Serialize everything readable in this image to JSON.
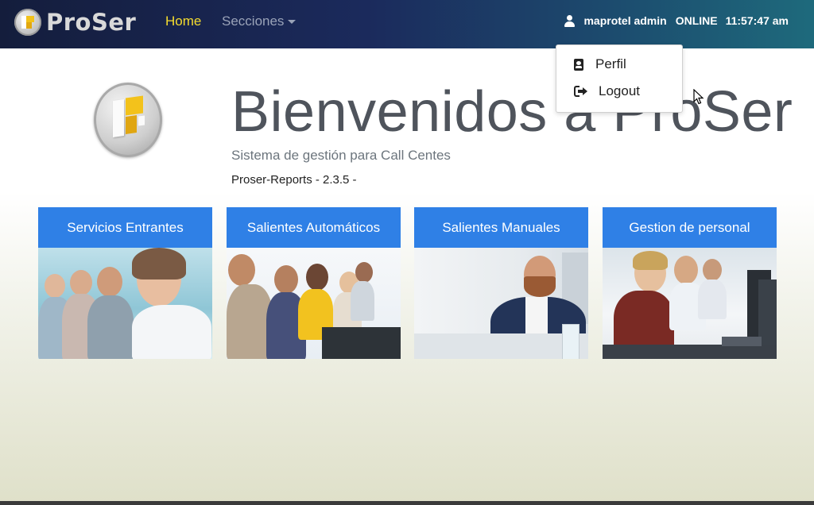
{
  "navbar": {
    "brand": "ProSer",
    "home": "Home",
    "secciones": "Secciones",
    "user": "maprotel admin",
    "status": "ONLINE",
    "time": "11:57:47 am"
  },
  "dropdown": {
    "items": [
      {
        "label": "Perfil",
        "icon": "profile-card-icon"
      },
      {
        "label": "Logout",
        "icon": "sign-out-icon"
      }
    ]
  },
  "hero": {
    "title": "Bienvenidos a ProSer",
    "subtitle": "Sistema de gestión para Call Centes",
    "version": "Proser-Reports - 2.3.5 -"
  },
  "cards": [
    {
      "label": "Servicios Entrantes"
    },
    {
      "label": "Salientes Automáticos"
    },
    {
      "label": "Salientes Manuales"
    },
    {
      "label": "Gestion de personal"
    }
  ],
  "colors": {
    "accent": "#2f80e6",
    "home_active": "#f5dc2e",
    "title": "#4f545c"
  }
}
